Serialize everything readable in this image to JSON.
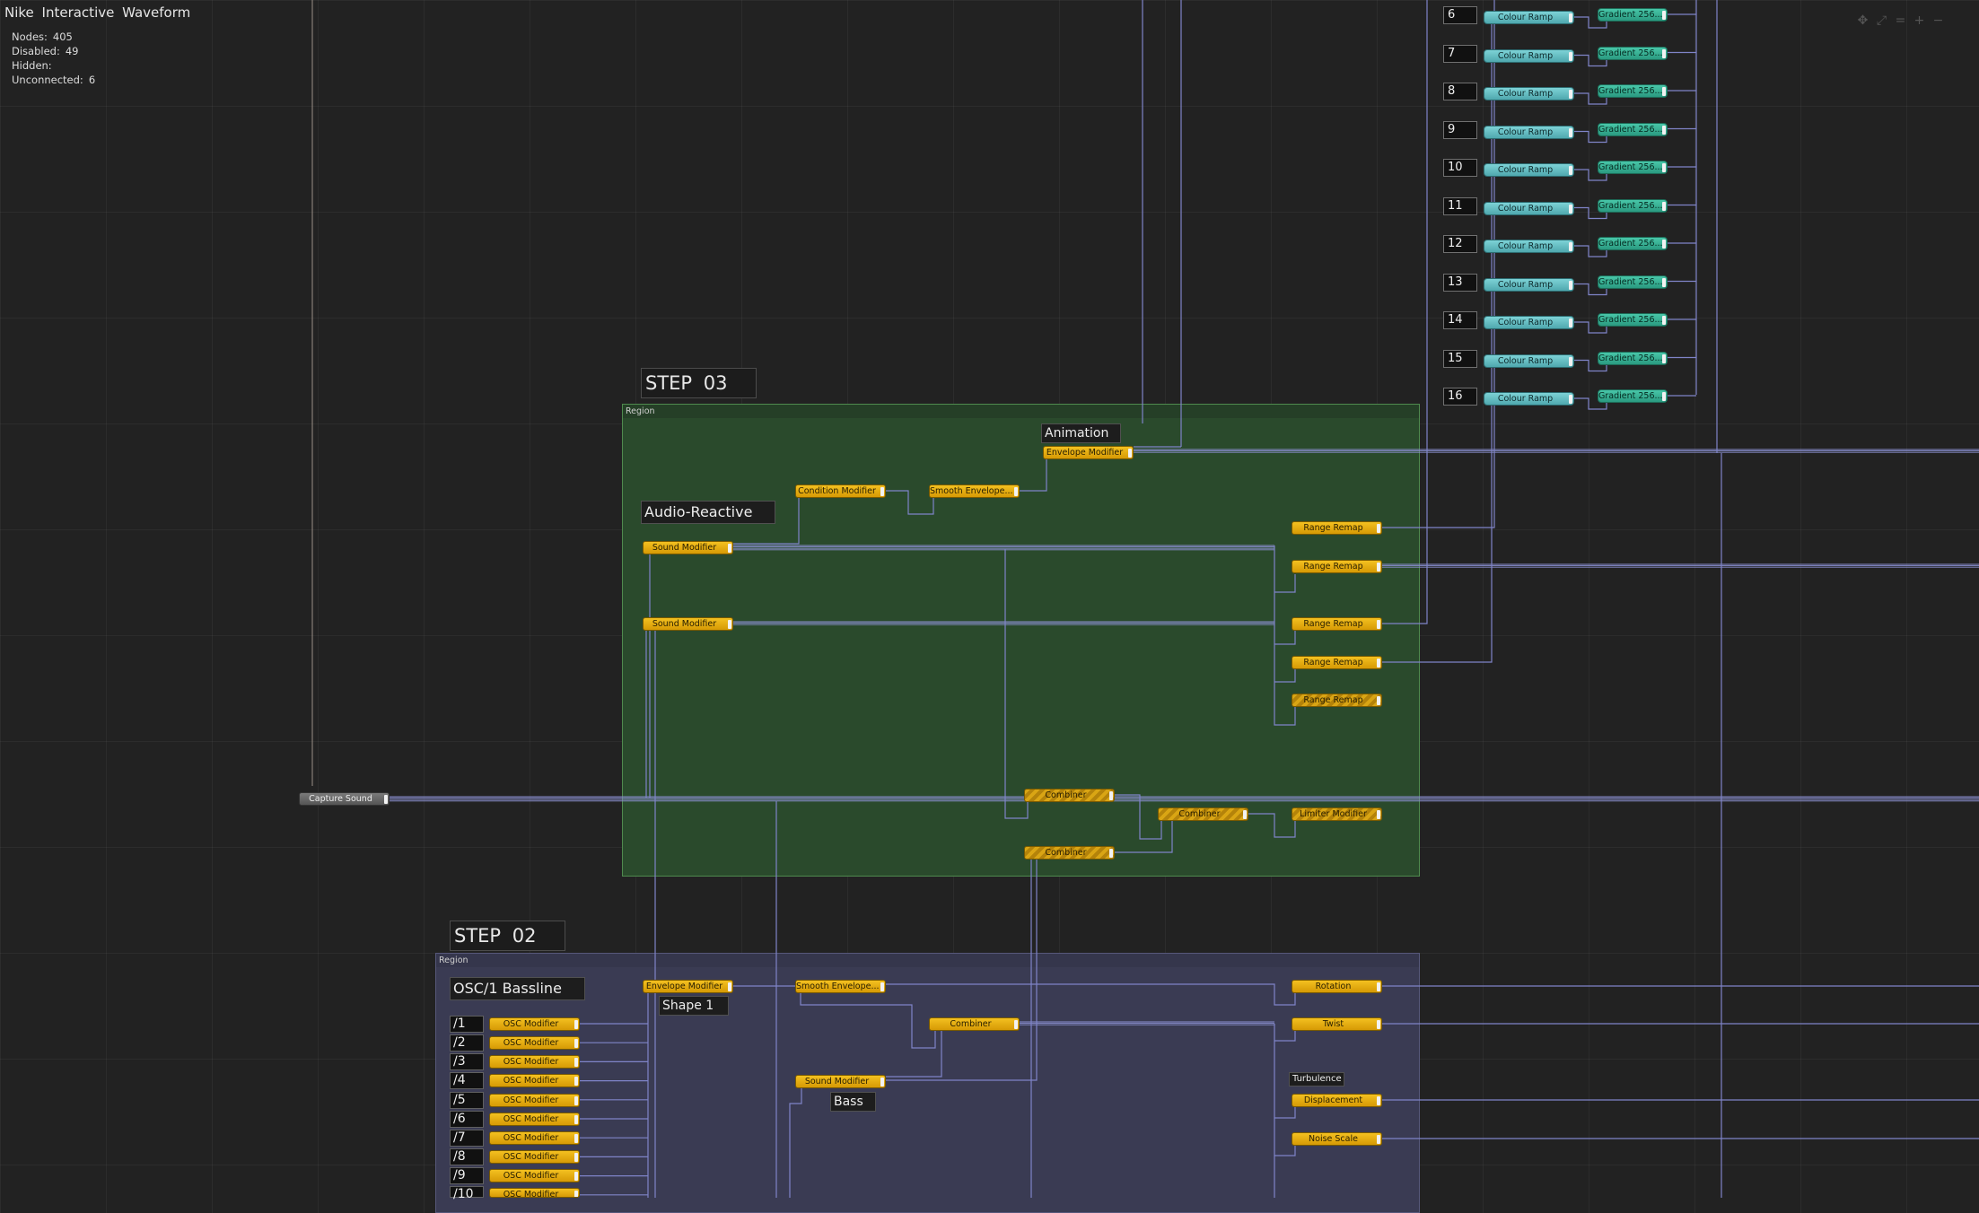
{
  "app": {
    "title": "Nike Interactive Waveform"
  },
  "stats": [
    {
      "label": "Nodes:",
      "value": "405"
    },
    {
      "label": "Disabled:",
      "value": "49"
    },
    {
      "label": "Hidden:",
      "value": ""
    },
    {
      "label": "Unconnected:",
      "value": "6"
    }
  ],
  "nav_icons": [
    "move-icon",
    "fit-icon",
    "equal-icon",
    "zoom-in-icon",
    "zoom-out-icon"
  ],
  "regions": {
    "step03": {
      "title": "STEP 03",
      "header": "Region"
    },
    "step02": {
      "title": "STEP 02",
      "header": "Region"
    }
  },
  "notes": {
    "animation": "Animation",
    "audio_reactive": "Audio-Reactive",
    "osc_bassline": "OSC/1 Bassline",
    "shape": "Shape 1",
    "bass": "Bass",
    "turbulence": "Turbulence"
  },
  "nodes": {
    "capture_sound": "Capture Sound",
    "envelope_modifier": "Envelope Modifier",
    "condition_modifier": "Condition Modifier",
    "smooth_envelope": "Smooth Envelope...",
    "sound_modifier": "Sound Modifier",
    "range_remap": "Range Remap",
    "combiner": "Combiner",
    "limiter_modifier": "Limiter Modifier",
    "rotation": "Rotation",
    "twist": "Twist",
    "displacement": "Displacement",
    "noise_scale": "Noise Scale",
    "osc_modifier": "OSC Modifier",
    "colour_ramp": "Colour Ramp",
    "gradient": "Gradient 256..."
  },
  "ramp_indices": [
    "6",
    "7",
    "8",
    "9",
    "10",
    "11",
    "12",
    "13",
    "14",
    "15",
    "16"
  ],
  "osc_indices": [
    "/1",
    "/2",
    "/3",
    "/4",
    "/5",
    "/6",
    "/7",
    "/8",
    "/9",
    "/10"
  ]
}
